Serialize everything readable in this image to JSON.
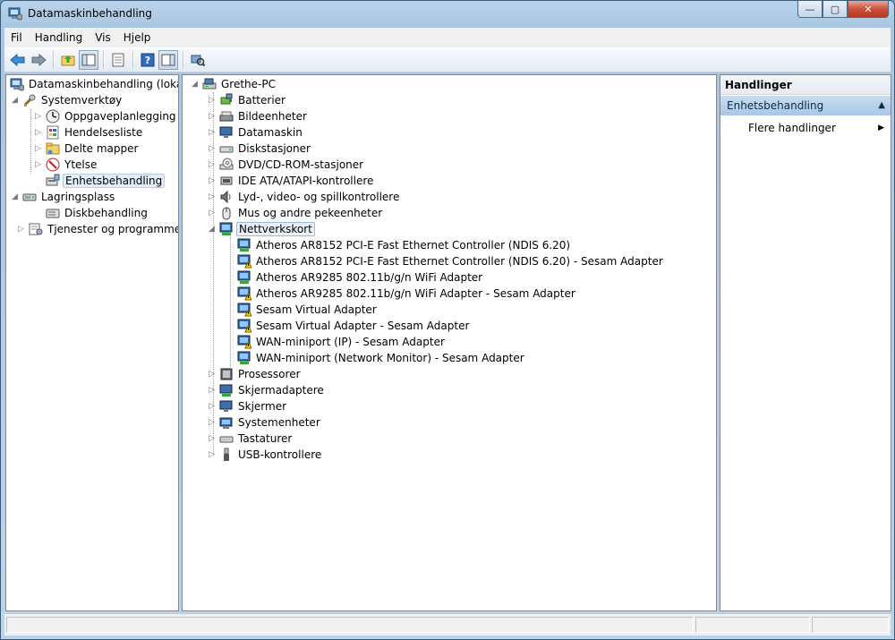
{
  "window": {
    "title": "Datamaskinbehandling",
    "buttons": {
      "minimize": "—",
      "maximize": "▢",
      "close": "✕"
    }
  },
  "menu": [
    "Fil",
    "Handling",
    "Vis",
    "Hjelp"
  ],
  "toolbar": {
    "icons": [
      "back-arrow-icon",
      "forward-arrow-icon",
      "up-folder-icon",
      "show-hide-tree-icon",
      "properties-icon",
      "help-icon",
      "show-hide-action-pane-icon",
      "scan-hardware-icon"
    ]
  },
  "left_tree": {
    "root": "Datamaskinbehandling (lokal)",
    "systemverktoy": "Systemverktøy",
    "items": [
      "Oppgaveplanlegging",
      "Hendelsesliste",
      "Delte mapper",
      "Ytelse",
      "Enhetsbehandling"
    ],
    "lagringsplass": "Lagringsplass",
    "diskbehandling": "Diskbehandling",
    "tjenester": "Tjenester og programmer"
  },
  "device_tree": {
    "root": "Grethe-PC",
    "categories_before": [
      "Batterier",
      "Bildeenheter",
      "Datamaskin",
      "Diskstasjoner",
      "DVD/CD-ROM-stasjoner",
      "IDE ATA/ATAPI-kontrollere",
      "Lyd-, video- og spillkontrollere",
      "Mus og andre pekeenheter"
    ],
    "network": "Nettverkskort",
    "adapters": [
      "Atheros AR8152 PCI-E Fast Ethernet Controller (NDIS 6.20)",
      "Atheros AR8152 PCI-E Fast Ethernet Controller (NDIS 6.20) - Sesam Adapter",
      "Atheros AR9285 802.11b/g/n WiFi Adapter",
      "Atheros AR9285 802.11b/g/n WiFi Adapter - Sesam Adapter",
      "Sesam Virtual Adapter",
      "Sesam Virtual Adapter - Sesam Adapter",
      "WAN-miniport (IP) - Sesam Adapter",
      "WAN-miniport (Network Monitor) - Sesam Adapter"
    ],
    "categories_after": [
      "Prosessorer",
      "Skjermadaptere",
      "Skjermer",
      "Systemenheter",
      "Tastaturer",
      "USB-kontrollere"
    ]
  },
  "actions": {
    "header": "Handlinger",
    "section": "Enhetsbehandling",
    "more": "Flere handlinger"
  }
}
